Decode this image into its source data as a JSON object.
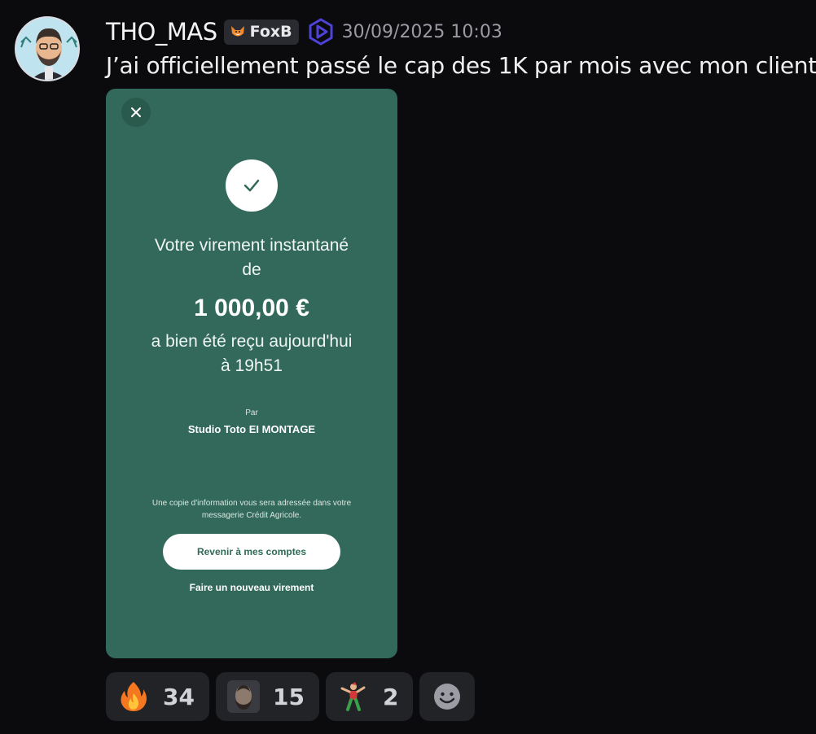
{
  "message": {
    "author": "THO_MAS",
    "role_tag": "FoxB",
    "timestamp": "30/09/2025 10:03",
    "text": "J’ai officiellement passé le cap des 1K par mois avec mon client"
  },
  "receipt": {
    "title_line1": "Votre virement instantané",
    "title_line2": "de",
    "amount": "1 000,00 €",
    "received_line1": "a bien été reçu aujourd'hui",
    "received_line2": "à 19h51",
    "par_label": "Par",
    "payer": "Studio Toto EI MONTAGE",
    "info_line1": "Une copie d'information vous sera adressée dans votre",
    "info_line2": "messagerie Crédit Agricole.",
    "primary_button": "Revenir à mes comptes",
    "secondary_link": "Faire un nouveau virement",
    "accent_color": "#32695a"
  },
  "reactions": [
    {
      "icon": "fire-emoji",
      "count": "34"
    },
    {
      "icon": "face-sticker-emoji",
      "count": "15"
    },
    {
      "icon": "dancing-figure-emoji",
      "count": "2"
    }
  ]
}
